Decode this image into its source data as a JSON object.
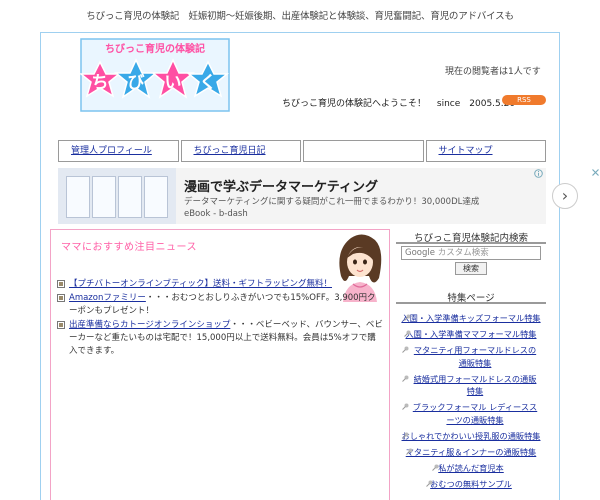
{
  "header": {
    "caption": "ちびっこ育児の体験記　妊娠初期〜妊娠後期、出産体験記と体験談、育児奮闘記、育児のアドバイスも",
    "logo_top": "ちびっこ育児の体験記",
    "logo_chars": [
      "ち",
      "び",
      "い",
      "く"
    ],
    "visitor_text": "現在の閲覧者は1人です",
    "welcome": "ちびっこ育児の体験記へようこそ！",
    "since": "since　2005.5.20",
    "rss": "RSS"
  },
  "nav": {
    "items": [
      {
        "label": "管理人プロフィール"
      },
      {
        "label": "ちびっこ育児日記"
      },
      {
        "label": ""
      },
      {
        "label": "サイトマップ"
      }
    ]
  },
  "ad": {
    "title": "漫画で学ぶデータマーケティング",
    "line1": "データマーケティングに関する疑問がこれ一冊でまるわかり！30,000DL達成",
    "line2": "eBook - b-dash",
    "arrow": "›"
  },
  "news": {
    "title": "ママにおすすめ注目ニュース",
    "items": [
      {
        "link": "【プチバトーオンラインブティック】送料・ギフトラッピング無料！",
        "text": ""
      },
      {
        "link": "Amazonファミリー",
        "text": "・・・おむつとおしりふきがいつでも15%OFF。3,900円クーポンもプレゼント！"
      },
      {
        "link": "出産準備ならカトージオンラインショップ",
        "text": "・・・ベビーベッド、バウンサー、ベビーカーなど重たいものは宅配で！15,000円以上で送料無料。会員は5%オフで購入できます。"
      }
    ]
  },
  "sidebar": {
    "search_title": "ちびっこ育児体験記内検索",
    "search_placeholder": "カスタム検索",
    "google": "Google",
    "search_button": "検索",
    "feature_title": "特集ページ",
    "features": [
      "入園・入学準備キッズフォーマル特集",
      "入園・入学準備ママフォーマル特集",
      "マタニティ用フォーマルドレスの通販特集",
      "結婚式用フォーマルドレスの通販特集",
      "ブラックフォーマル レディーススーツの通販特集",
      "おしゃれでかわいい授乳服の通販特集",
      "マタニティ服＆インナーの通販特集",
      "私が読んだ育児本",
      "おむつの無料サンプル"
    ]
  },
  "colors": {
    "frame": "#9fd0f0",
    "news_border": "#f3a3c6",
    "news_title": "#ff5fa6",
    "link": "#1a2f9f",
    "rss": "#f07a2c",
    "logo_pink": "#ff4fa3",
    "logo_blue": "#39a9e8"
  }
}
